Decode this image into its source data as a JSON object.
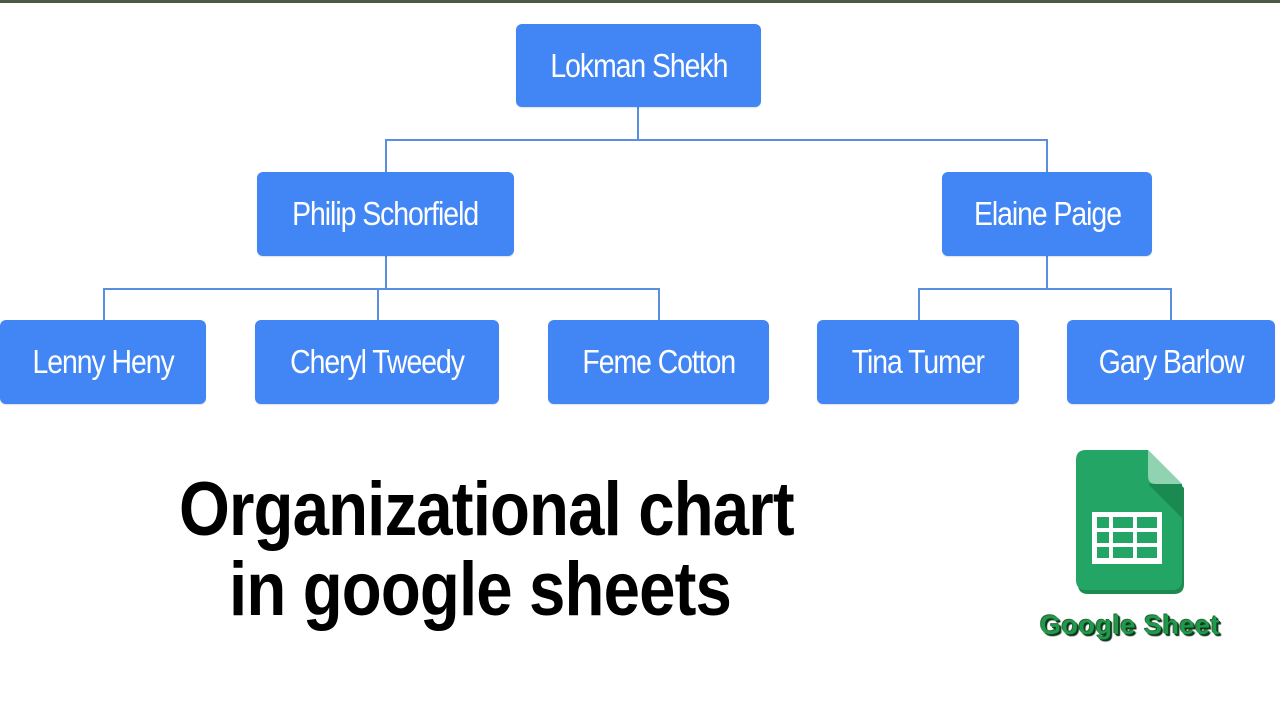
{
  "diagram": {
    "type": "organizational-chart",
    "root": {
      "id": "lokman",
      "label": "Lokman Shekh",
      "children": [
        {
          "id": "philip",
          "label": "Philip Schorfield",
          "children": [
            {
              "id": "lenny",
              "label": "Lenny Heny"
            },
            {
              "id": "cheryl",
              "label": "Cheryl Tweedy"
            },
            {
              "id": "feme",
              "label": "Feme Cotton"
            }
          ]
        },
        {
          "id": "elaine",
          "label": "Elaine Paige",
          "children": [
            {
              "id": "tina",
              "label": "Tina Tumer"
            },
            {
              "id": "gary",
              "label": "Gary Barlow"
            }
          ]
        }
      ]
    },
    "nodes": {
      "lokman": "Lokman Shekh",
      "philip": "Philip Schorfield",
      "elaine": "Elaine Paige",
      "lenny": "Lenny Heny",
      "cheryl": "Cheryl Tweedy",
      "feme": "Feme Cotton",
      "tina": "Tina Tumer",
      "gary": "Gary Barlow"
    },
    "node_color": "#4285f4",
    "connector_color": "#5b8ee0"
  },
  "caption": {
    "line1": "Organizational chart",
    "line2": "in google sheets"
  },
  "logo": {
    "icon": "google-sheets-icon",
    "label": "Google Sheet",
    "brand_color": "#23a566"
  }
}
